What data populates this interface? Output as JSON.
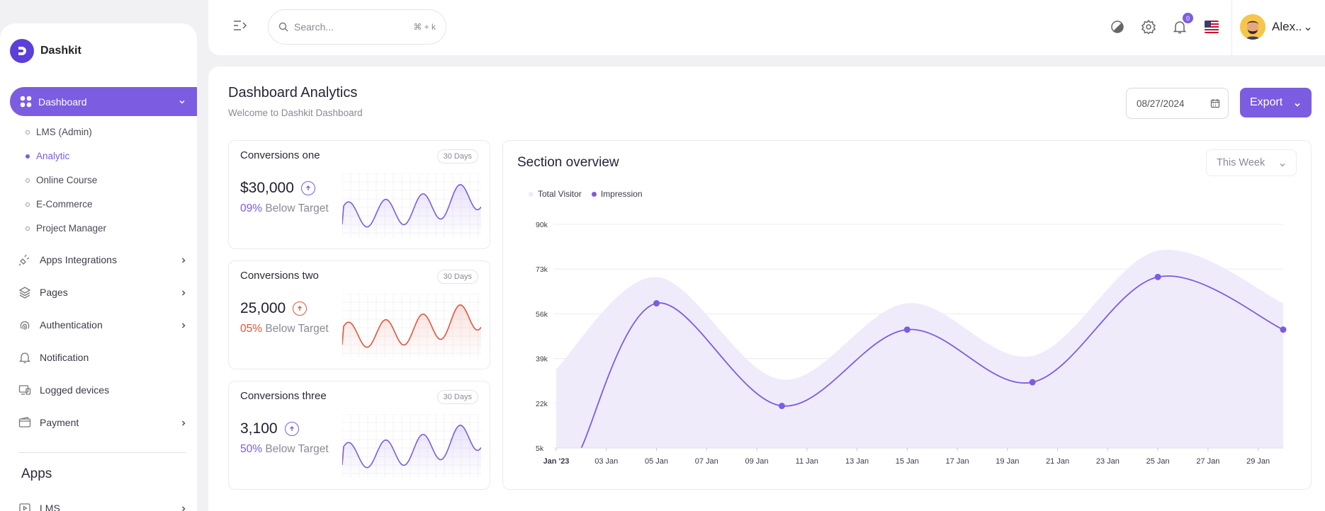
{
  "brand": {
    "name": "Dashkit"
  },
  "sidebar": {
    "active": {
      "label": "Dashboard"
    },
    "sub_items": [
      {
        "label": "LMS (Admin)"
      },
      {
        "label": "Analytic"
      },
      {
        "label": "Online Course"
      },
      {
        "label": "E-Commerce"
      },
      {
        "label": "Project Manager"
      }
    ],
    "items": [
      {
        "label": "Apps Integrations",
        "icon": "plug-icon",
        "has_chevron": true
      },
      {
        "label": "Pages",
        "icon": "layers-icon",
        "has_chevron": true
      },
      {
        "label": "Authentication",
        "icon": "fingerprint-icon",
        "has_chevron": true
      },
      {
        "label": "Notification",
        "icon": "bell-icon",
        "has_chevron": false
      },
      {
        "label": "Logged devices",
        "icon": "devices-icon",
        "has_chevron": false
      },
      {
        "label": "Payment",
        "icon": "wallet-icon",
        "has_chevron": true
      }
    ],
    "section_title": "Apps",
    "apps_items": [
      {
        "label": "LMS"
      }
    ]
  },
  "topbar": {
    "search_placeholder": "Search...",
    "search_shortcut": "⌘ + k",
    "notification_count": "0",
    "username": "Alex.."
  },
  "header": {
    "title": "Dashboard Analytics",
    "subtitle": "Welcome to Dashkit Dashboard",
    "date_value": "08/27/2024",
    "export_label": "Export"
  },
  "cards": [
    {
      "title": "Conversions one",
      "badge": "30 Days",
      "value": "$30,000",
      "percent": "09%",
      "target_text": "Below Target",
      "color": "#7c5ce0"
    },
    {
      "title": "Conversions two",
      "badge": "30 Days",
      "value": "25,000",
      "percent": "05%",
      "target_text": "Below Target",
      "color": "#e2553a"
    },
    {
      "title": "Conversions three",
      "badge": "30 Days",
      "value": "3,100",
      "percent": "50%",
      "target_text": "Below Target",
      "color": "#7c5ce0"
    }
  ],
  "overview": {
    "title": "Section overview",
    "filter": "This Week"
  },
  "chart_data": {
    "type": "area",
    "title": "Section overview",
    "legend_position": "top-left",
    "grid": true,
    "y_ticks": [
      "90k",
      "73k",
      "56k",
      "39k",
      "22k",
      "5k"
    ],
    "ylim": [
      5000,
      90000
    ],
    "x_labels": [
      "Jan '23",
      "03 Jan",
      "05 Jan",
      "07 Jan",
      "09 Jan",
      "11 Jan",
      "13 Jan",
      "15 Jan",
      "17 Jan",
      "19 Jan",
      "21 Jan",
      "23 Jan",
      "25 Jan",
      "27 Jan",
      "29 Jan"
    ],
    "series": [
      {
        "name": "Total Visitor",
        "color": "#f0ebfb",
        "x": [
          1,
          5,
          10,
          15,
          20,
          25,
          30
        ],
        "values": [
          35000,
          70000,
          31000,
          60000,
          40000,
          80000,
          60000
        ]
      },
      {
        "name": "Impression",
        "color": "#7c5ce0",
        "x": [
          2,
          5,
          10,
          15,
          20,
          25,
          30
        ],
        "values": [
          5000,
          60000,
          21000,
          50000,
          30000,
          70000,
          50000
        ]
      }
    ]
  }
}
